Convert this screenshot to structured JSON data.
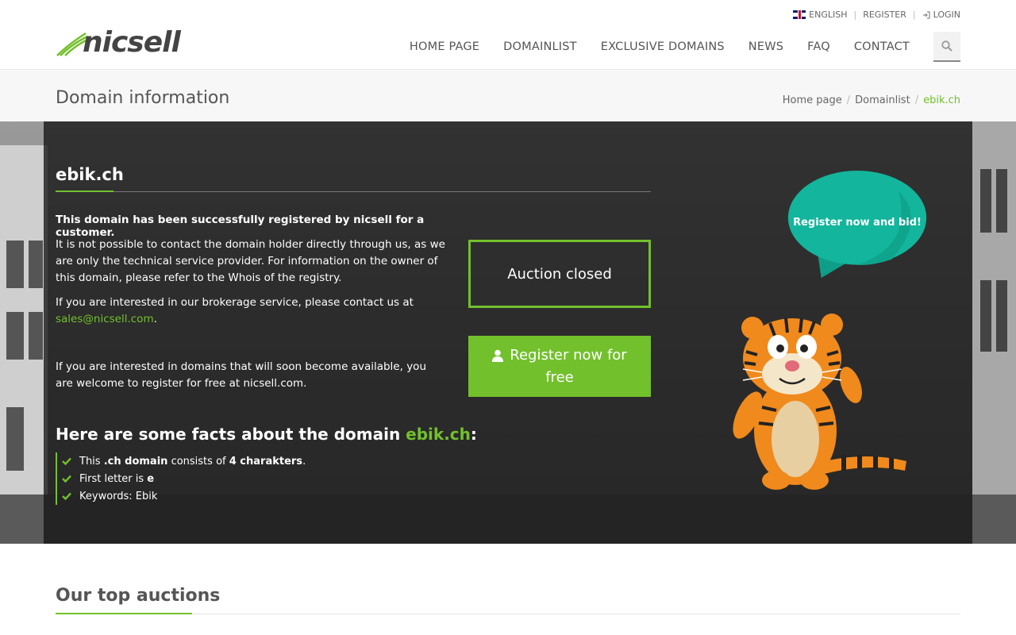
{
  "header": {
    "lang_label": "ENGLISH",
    "register_label": "REGISTER",
    "login_label": "LOGIN",
    "logo_text": "nicsell",
    "nav": [
      {
        "label": "HOME PAGE"
      },
      {
        "label": "DOMAINLIST"
      },
      {
        "label": "EXCLUSIVE DOMAINS"
      },
      {
        "label": "NEWS"
      },
      {
        "label": "FAQ"
      },
      {
        "label": "CONTACT"
      }
    ]
  },
  "titlebar": {
    "title": "Domain information",
    "breadcrumb": [
      "Home page",
      "Domainlist",
      "ebik.ch"
    ]
  },
  "hero": {
    "domain": "ebik.ch",
    "bold_text": "This domain has been successfully registered by nicsell for a customer.",
    "para1": "It is not possible to contact the domain holder directly through us, as we are only the technical service provider. For information on the owner of this domain, please refer to the Whois of the registry.",
    "para2_prefix": "If you are interested in our brokerage service, please contact us at",
    "para2_email": "sales@nicsell.com",
    "para2_suffix": ".",
    "para3": "If you are interested in domains that will soon become available, you are welcome to register for free at nicsell.com.",
    "auction_status": "Auction closed",
    "register_btn": "Register now for free",
    "facts_prefix": "Here are some facts about the domain",
    "facts_domain": "ebik.ch",
    "facts_suffix": ":",
    "fact1": {
      "a": "This",
      "b": ".ch domain",
      "c": "consists of",
      "d": "4 charakters",
      "e": "."
    },
    "fact2": {
      "a": "First letter is",
      "b": "e"
    },
    "fact3": {
      "a": "Keywords: Ebik"
    },
    "bubble_text": "Register now and bid!"
  },
  "bottom": {
    "title": "Our top auctions"
  },
  "colors": {
    "accent": "#72c02c",
    "bubble": "#13b59c"
  }
}
